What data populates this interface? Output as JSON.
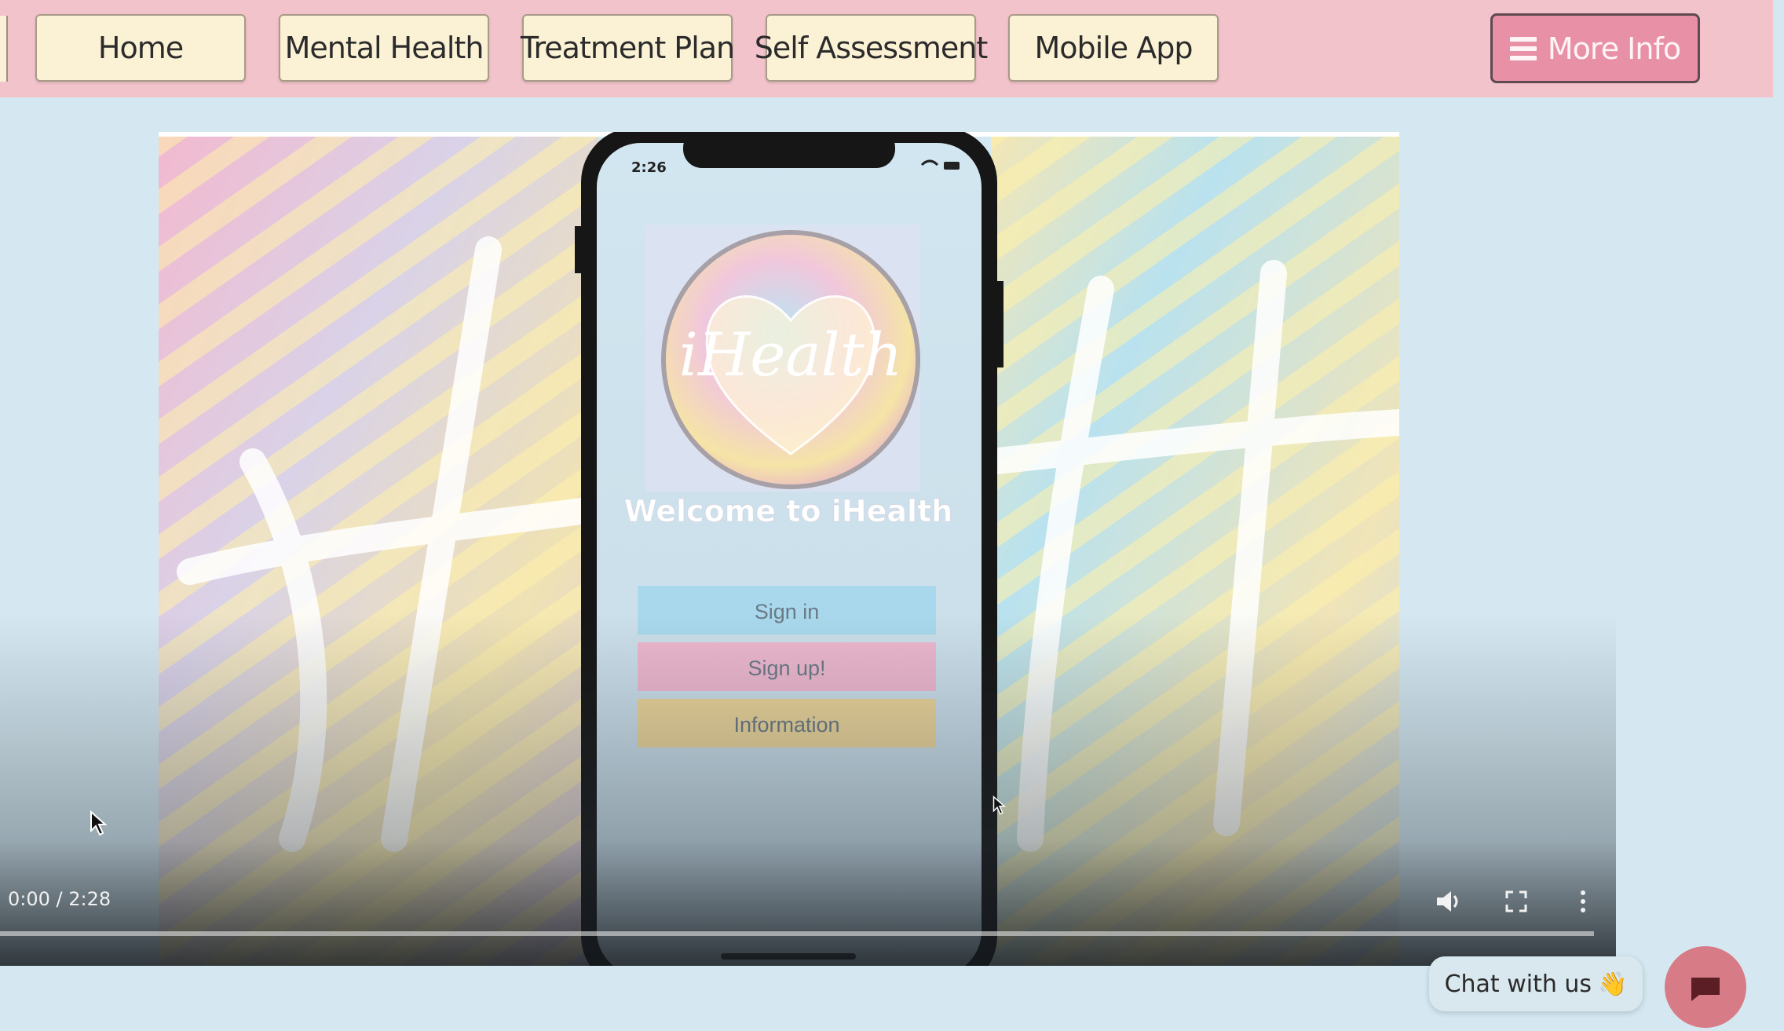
{
  "nav": {
    "items": [
      {
        "label": "Home"
      },
      {
        "label": "Mental Health"
      },
      {
        "label": "Treatment Plan"
      },
      {
        "label": "Self Assessment"
      },
      {
        "label": "Mobile App"
      }
    ],
    "more_info": {
      "label": "More Info",
      "icon": "hamburger-icon"
    }
  },
  "video": {
    "time": "0:00 / 2:28",
    "progress": 0,
    "controls": [
      "volume-icon",
      "fullscreen-icon",
      "more-options-icon"
    ]
  },
  "phone": {
    "status_time": "2:26",
    "logo_text": "iHealth",
    "welcome": "Welcome to iHealth",
    "buttons": [
      {
        "label": "Sign in",
        "color": "#a9d8ec"
      },
      {
        "label": "Sign up!",
        "color": "#eeb8cf"
      },
      {
        "label": "Information",
        "color": "#ecd59a"
      }
    ]
  },
  "chat": {
    "label": "Chat with us",
    "emoji": "👋"
  },
  "colors": {
    "navbar_bg": "#f2c3cb",
    "nav_button_bg": "#fbf1d5",
    "more_info_bg": "#e890a6",
    "page_bg": "#d5e8f1",
    "chat_fab": "#d77b86"
  }
}
